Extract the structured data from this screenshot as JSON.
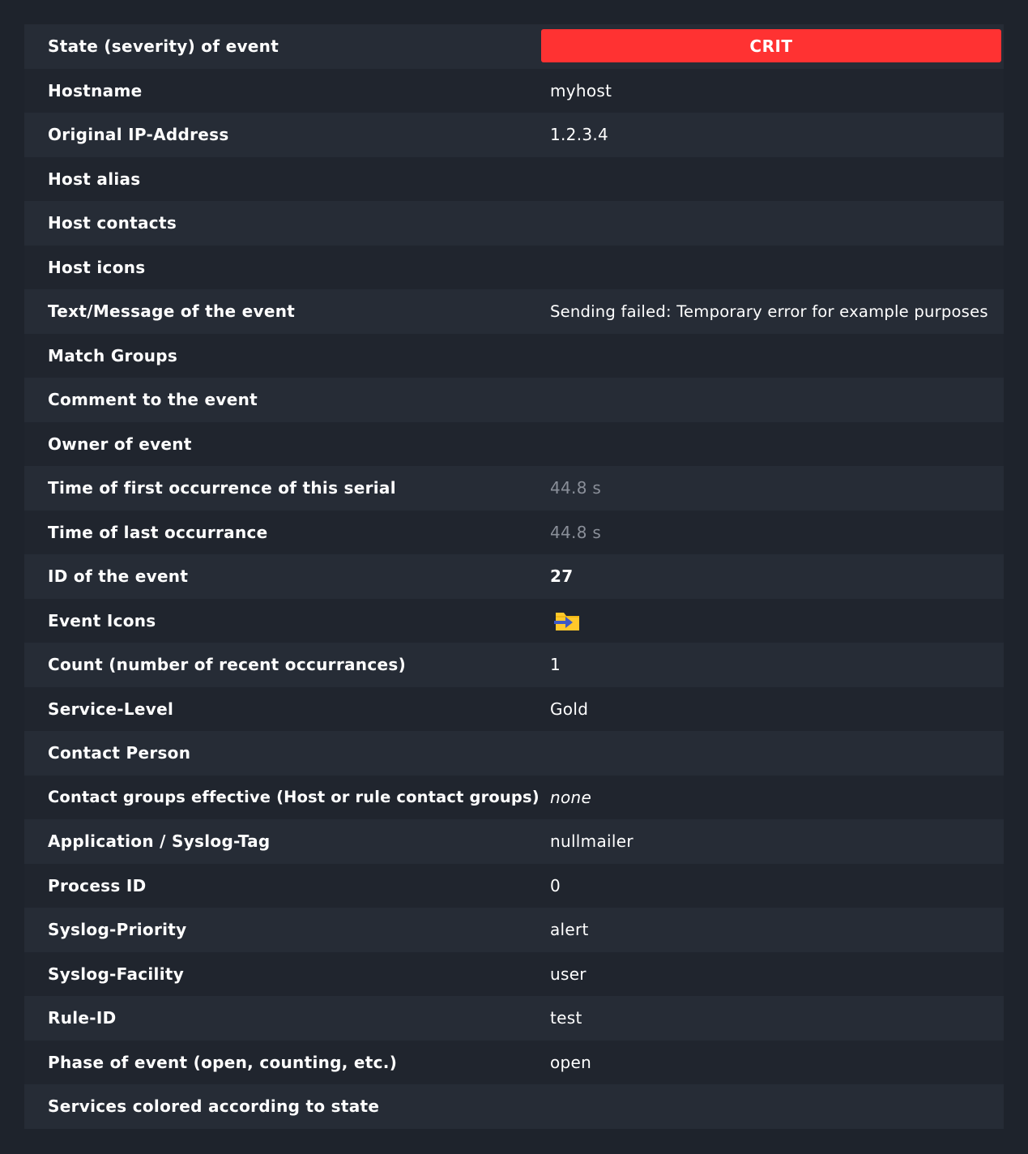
{
  "rows": [
    {
      "label": "State (severity) of event",
      "value": "CRIT"
    },
    {
      "label": "Hostname",
      "value": "myhost"
    },
    {
      "label": "Original IP-Address",
      "value": "1.2.3.4"
    },
    {
      "label": "Host alias",
      "value": ""
    },
    {
      "label": "Host contacts",
      "value": ""
    },
    {
      "label": "Host icons",
      "value": ""
    },
    {
      "label": "Text/Message of the event",
      "value": "Sending failed: Temporary error for example purposes"
    },
    {
      "label": "Match Groups",
      "value": ""
    },
    {
      "label": "Comment to the event",
      "value": ""
    },
    {
      "label": "Owner of event",
      "value": ""
    },
    {
      "label": "Time of first occurrence of this serial",
      "value": "44.8 s"
    },
    {
      "label": "Time of last occurrance",
      "value": "44.8 s"
    },
    {
      "label": "ID of the event",
      "value": "27"
    },
    {
      "label": "Event Icons",
      "value": "",
      "icon": "event-folder-arrow-icon"
    },
    {
      "label": "Count (number of recent occurrances)",
      "value": "1"
    },
    {
      "label": "Service-Level",
      "value": "Gold"
    },
    {
      "label": "Contact Person",
      "value": ""
    },
    {
      "label": "Contact groups effective (Host or rule contact groups)",
      "value": "none"
    },
    {
      "label": "Application / Syslog-Tag",
      "value": "nullmailer"
    },
    {
      "label": "Process ID",
      "value": "0"
    },
    {
      "label": "Syslog-Priority",
      "value": "alert"
    },
    {
      "label": "Syslog-Facility",
      "value": "user"
    },
    {
      "label": "Rule-ID",
      "value": "test"
    },
    {
      "label": "Phase of event (open, counting, etc.)",
      "value": "open"
    },
    {
      "label": "Services colored according to state",
      "value": ""
    }
  ],
  "colors": {
    "crit": "#ff3232",
    "background": "#1e232c",
    "row_odd": "#262c36",
    "row_even": "#20252e",
    "muted_text": "#8a8f99",
    "icon_folder": "#ffc82a",
    "icon_arrow": "#3d59c4"
  }
}
